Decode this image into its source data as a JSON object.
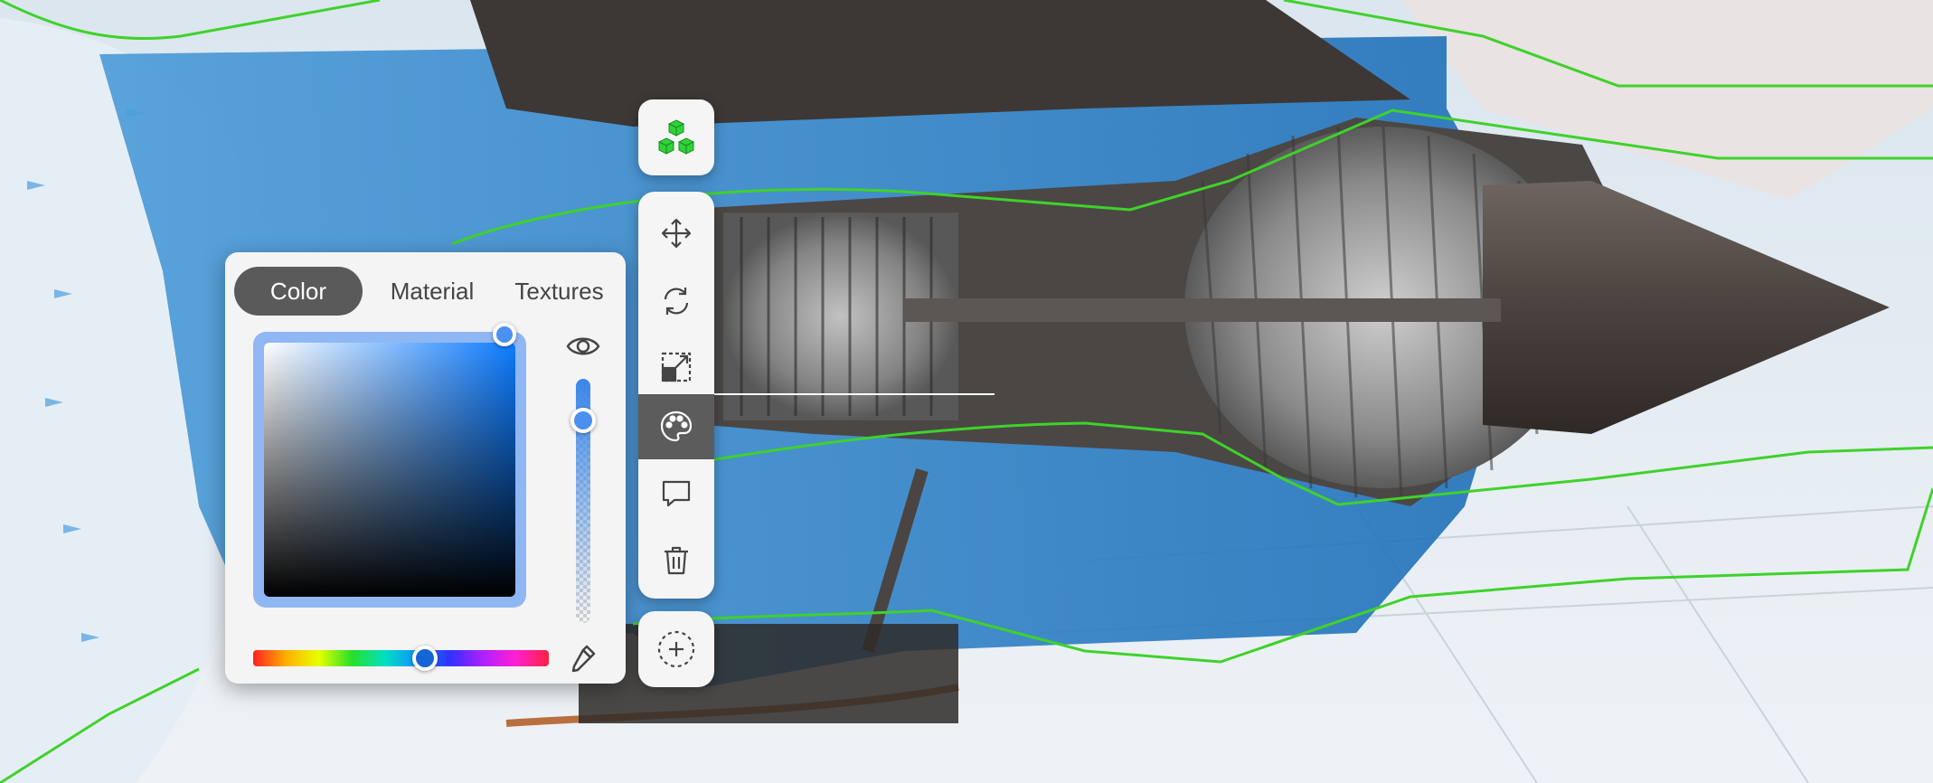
{
  "picker": {
    "tabs": [
      {
        "label": "Color",
        "active": true
      },
      {
        "label": "Material",
        "active": false
      },
      {
        "label": "Textures",
        "active": false
      }
    ],
    "selected_color": "#0d7bff",
    "hue_value": 0.58,
    "opacity_value": 0.83,
    "icons": {
      "visibility": "eye-icon",
      "eyedropper": "eyedropper-icon"
    }
  },
  "toolbar": {
    "objects_icon": "cubes-icon",
    "tools": [
      {
        "name": "move",
        "icon": "move-icon",
        "active": false
      },
      {
        "name": "rotate",
        "icon": "rotate-icon",
        "active": false
      },
      {
        "name": "scale",
        "icon": "scale-icon",
        "active": false
      },
      {
        "name": "paint",
        "icon": "palette-icon",
        "active": true
      },
      {
        "name": "comment",
        "icon": "comment-icon",
        "active": false
      },
      {
        "name": "delete",
        "icon": "trash-icon",
        "active": false
      }
    ],
    "add_icon": "add-circle-icon"
  },
  "colors": {
    "accent": "#2fd23a",
    "flow_green": "#3fd22a",
    "panel_bg": "#f4f4f4",
    "tab_active_bg": "#5a5a5a"
  }
}
